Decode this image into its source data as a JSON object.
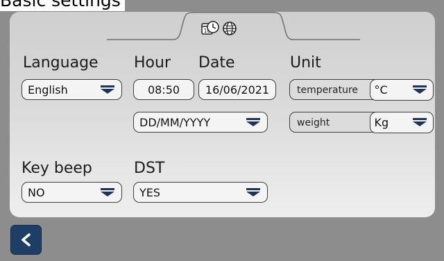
{
  "title": "Basic settings",
  "tabs": [
    {
      "icons": [
        "calendar-clock-icon",
        "globe-icon"
      ],
      "active": true
    }
  ],
  "labels": {
    "language": "Language",
    "hour": "Hour",
    "date": "Date",
    "unit": "Unit",
    "key_beep": "Key beep",
    "dst": "DST"
  },
  "fields": {
    "language": "English",
    "hour": "08:50",
    "date": "16/06/2021",
    "date_format": "DD/MM/YYYY",
    "key_beep": "NO",
    "dst": "YES"
  },
  "units": [
    {
      "label": "temperature",
      "value": "°C"
    },
    {
      "label": "weight",
      "value": "Kg"
    }
  ],
  "colors": {
    "background": "#8d8d8d",
    "panel": "#dadada",
    "accent": "#1e3e66",
    "field_border": "#3d3d3d"
  },
  "icons": {
    "back": "chevron-left-icon",
    "dropdown": "caret-down-icon"
  }
}
